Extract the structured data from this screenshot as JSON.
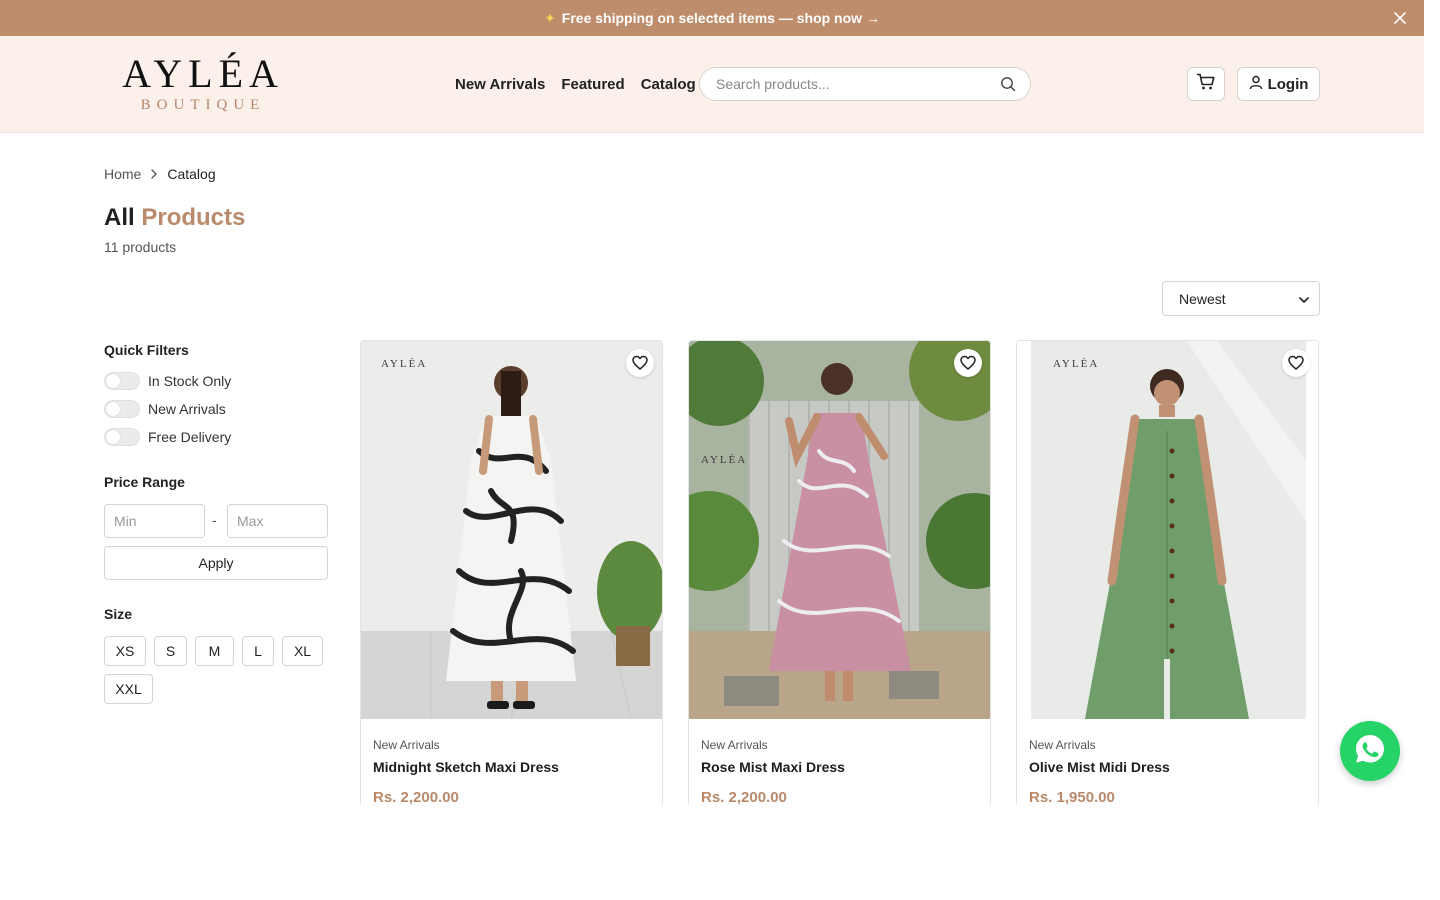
{
  "announcement": {
    "text": "Free shipping on selected items — shop now →",
    "icon": "sparkle-icon",
    "close_icon": "close-icon",
    "bg_color": "#be8d6c"
  },
  "header": {
    "logo_brand": "AYLÉA",
    "logo_sub": "BOUTIQUE",
    "nav": [
      "New Arrivals",
      "Featured",
      "Catalog"
    ],
    "search_placeholder": "Search products...",
    "login_label": "Login",
    "bg_color": "#fbf1ea"
  },
  "breadcrumb": {
    "home": "Home",
    "current": "Catalog"
  },
  "page": {
    "title_part1": "All",
    "title_part2": "Products",
    "count": "11 products",
    "accent_color": "#b98a6b"
  },
  "sort": {
    "selected": "Newest"
  },
  "filters": {
    "quick_title": "Quick Filters",
    "toggles": [
      {
        "label": "In Stock Only",
        "on": false
      },
      {
        "label": "New Arrivals",
        "on": false
      },
      {
        "label": "Free Delivery",
        "on": false
      }
    ],
    "price_title": "Price Range",
    "min_placeholder": "Min",
    "max_placeholder": "Max",
    "dash": "-",
    "apply_label": "Apply",
    "size_title": "Size",
    "sizes": [
      "XS",
      "S",
      "M",
      "L",
      "XL",
      "XXL"
    ]
  },
  "products": [
    {
      "category": "New Arrivals",
      "name": "Midnight Sketch Maxi Dress",
      "price": "Rs. 2,200.00",
      "watermark": "AYLÉA",
      "dress_color": "#f4f4f2"
    },
    {
      "category": "New Arrivals",
      "name": "Rose Mist Maxi Dress",
      "price": "Rs. 2,200.00",
      "watermark": "AYLÉA",
      "dress_color": "#c98fa3"
    },
    {
      "category": "New Arrivals",
      "name": "Olive Mist Midi Dress",
      "price": "Rs. 1,950.00",
      "watermark": "AYLÉA",
      "dress_color": "#6f9e6b"
    }
  ],
  "whatsapp": {
    "icon": "whatsapp-icon",
    "color": "#25d366"
  }
}
